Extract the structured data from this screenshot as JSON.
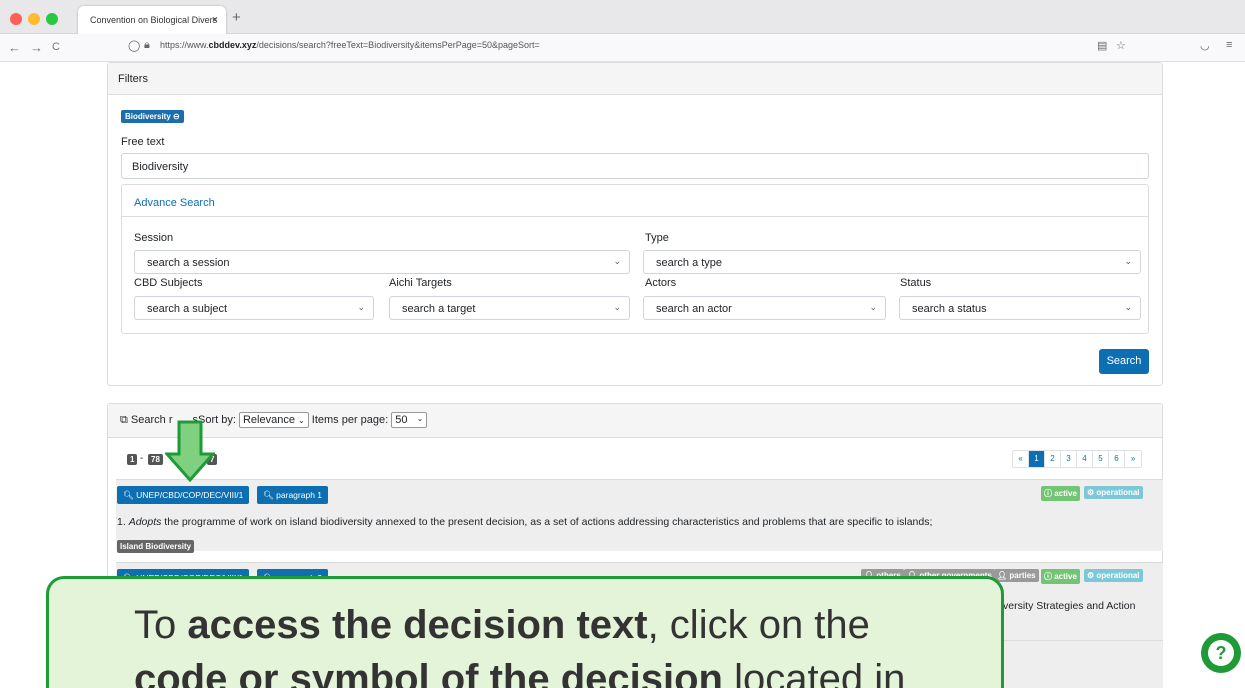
{
  "browser": {
    "tab_title": "Convention on Biological Divers",
    "tab_close": "×",
    "new_tab": "+",
    "back": "←",
    "forward": "→",
    "reload": "C",
    "url_prefix": "https://www.",
    "url_domain": "cbddev.xyz",
    "url_path": "/decisions/search?freeText=Biodiversity&itemsPerPage=50&pageSort=",
    "icons": [
      "shield-icon",
      "lock-icon",
      "reader-view-icon",
      "bookmark-star-icon",
      "pocket-icon",
      "menu-icon"
    ]
  },
  "filters": {
    "header": "Filters",
    "active_badge": "Biodiversity ⊖",
    "free_text_label": "Free text",
    "free_text_value": "Biodiversity",
    "advance_search_label": "Advance Search",
    "session_label": "Session",
    "session_placeholder": "search a session",
    "type_label": "Type",
    "type_placeholder": "search a type",
    "subjects_label": "CBD Subjects",
    "subjects_placeholder": "search a subject",
    "aichi_label": "Aichi Targets",
    "aichi_placeholder": "search a target",
    "actors_label": "Actors",
    "actors_placeholder": "search an actor",
    "status_label": "Status",
    "status_placeholder": "search a status",
    "search_button": "Search"
  },
  "results": {
    "header_prefix": "Search r",
    "header_suffix": "sSort by:",
    "sort_value": "Relevance",
    "items_per_page_label": "Items per page:",
    "items_per_page_value": "50",
    "range_start": "1",
    "range_dash": "-",
    "range_end": "78",
    "total": "7",
    "pager": [
      "«",
      "1",
      "2",
      "3",
      "4",
      "5",
      "6",
      "»"
    ],
    "items": [
      {
        "decision": "UNEP/CBD/COP/DEC/VIII/1",
        "paragraph": "paragraph 1",
        "statuses": [
          "active",
          "operational"
        ],
        "text_em": "Adopts",
        "text_prefix": "1. ",
        "text_rest": " the programme of work on island biodiversity annexed to the present decision, as a set of actions addressing characteristics and problems that are specific to islands;",
        "subject_tag": "Island Biodiversity"
      },
      {
        "decision": "UNEP/CBD/COP/DEC/VIII/1",
        "paragraph": "paragraph 3",
        "actors": [
          "others",
          "other governments",
          "parties"
        ],
        "statuses": [
          "active",
          "operational"
        ],
        "text_tail": "versity Strategies and Action"
      }
    ]
  },
  "callout": {
    "line1_prefix": "To ",
    "line1_bold": "access the decision text",
    "line1_suffix": ", click on the",
    "line2_bold": "code or symbol of the decision",
    "line2_suffix": " located in"
  },
  "help_icon": "?",
  "colors": {
    "primary": "#0d6eb1",
    "callout_border": "#1e9a36",
    "callout_fill": "#e3f4d8",
    "active_green": "#74c476",
    "operational_teal": "#7dc8d6"
  }
}
